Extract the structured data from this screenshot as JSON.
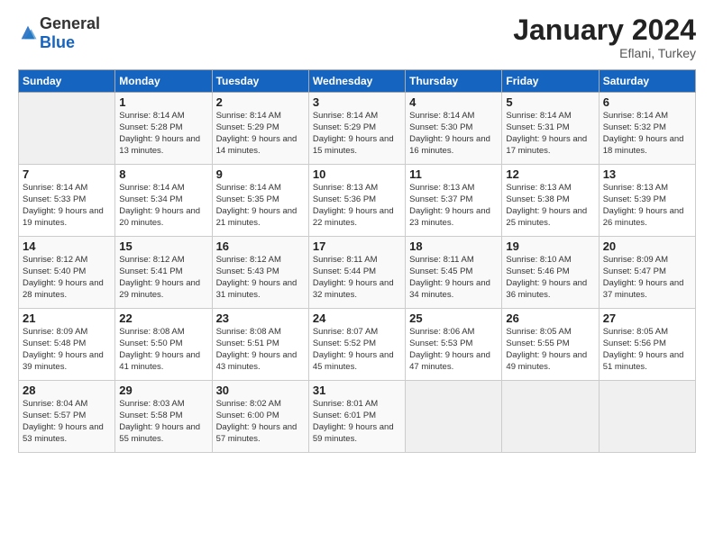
{
  "header": {
    "logo_general": "General",
    "logo_blue": "Blue",
    "month": "January 2024",
    "location": "Eflani, Turkey"
  },
  "days_of_week": [
    "Sunday",
    "Monday",
    "Tuesday",
    "Wednesday",
    "Thursday",
    "Friday",
    "Saturday"
  ],
  "weeks": [
    {
      "days": [
        {
          "num": "",
          "sunrise": "",
          "sunset": "",
          "daylight": ""
        },
        {
          "num": "1",
          "sunrise": "Sunrise: 8:14 AM",
          "sunset": "Sunset: 5:28 PM",
          "daylight": "Daylight: 9 hours and 13 minutes."
        },
        {
          "num": "2",
          "sunrise": "Sunrise: 8:14 AM",
          "sunset": "Sunset: 5:29 PM",
          "daylight": "Daylight: 9 hours and 14 minutes."
        },
        {
          "num": "3",
          "sunrise": "Sunrise: 8:14 AM",
          "sunset": "Sunset: 5:29 PM",
          "daylight": "Daylight: 9 hours and 15 minutes."
        },
        {
          "num": "4",
          "sunrise": "Sunrise: 8:14 AM",
          "sunset": "Sunset: 5:30 PM",
          "daylight": "Daylight: 9 hours and 16 minutes."
        },
        {
          "num": "5",
          "sunrise": "Sunrise: 8:14 AM",
          "sunset": "Sunset: 5:31 PM",
          "daylight": "Daylight: 9 hours and 17 minutes."
        },
        {
          "num": "6",
          "sunrise": "Sunrise: 8:14 AM",
          "sunset": "Sunset: 5:32 PM",
          "daylight": "Daylight: 9 hours and 18 minutes."
        }
      ]
    },
    {
      "days": [
        {
          "num": "7",
          "sunrise": "Sunrise: 8:14 AM",
          "sunset": "Sunset: 5:33 PM",
          "daylight": "Daylight: 9 hours and 19 minutes."
        },
        {
          "num": "8",
          "sunrise": "Sunrise: 8:14 AM",
          "sunset": "Sunset: 5:34 PM",
          "daylight": "Daylight: 9 hours and 20 minutes."
        },
        {
          "num": "9",
          "sunrise": "Sunrise: 8:14 AM",
          "sunset": "Sunset: 5:35 PM",
          "daylight": "Daylight: 9 hours and 21 minutes."
        },
        {
          "num": "10",
          "sunrise": "Sunrise: 8:13 AM",
          "sunset": "Sunset: 5:36 PM",
          "daylight": "Daylight: 9 hours and 22 minutes."
        },
        {
          "num": "11",
          "sunrise": "Sunrise: 8:13 AM",
          "sunset": "Sunset: 5:37 PM",
          "daylight": "Daylight: 9 hours and 23 minutes."
        },
        {
          "num": "12",
          "sunrise": "Sunrise: 8:13 AM",
          "sunset": "Sunset: 5:38 PM",
          "daylight": "Daylight: 9 hours and 25 minutes."
        },
        {
          "num": "13",
          "sunrise": "Sunrise: 8:13 AM",
          "sunset": "Sunset: 5:39 PM",
          "daylight": "Daylight: 9 hours and 26 minutes."
        }
      ]
    },
    {
      "days": [
        {
          "num": "14",
          "sunrise": "Sunrise: 8:12 AM",
          "sunset": "Sunset: 5:40 PM",
          "daylight": "Daylight: 9 hours and 28 minutes."
        },
        {
          "num": "15",
          "sunrise": "Sunrise: 8:12 AM",
          "sunset": "Sunset: 5:41 PM",
          "daylight": "Daylight: 9 hours and 29 minutes."
        },
        {
          "num": "16",
          "sunrise": "Sunrise: 8:12 AM",
          "sunset": "Sunset: 5:43 PM",
          "daylight": "Daylight: 9 hours and 31 minutes."
        },
        {
          "num": "17",
          "sunrise": "Sunrise: 8:11 AM",
          "sunset": "Sunset: 5:44 PM",
          "daylight": "Daylight: 9 hours and 32 minutes."
        },
        {
          "num": "18",
          "sunrise": "Sunrise: 8:11 AM",
          "sunset": "Sunset: 5:45 PM",
          "daylight": "Daylight: 9 hours and 34 minutes."
        },
        {
          "num": "19",
          "sunrise": "Sunrise: 8:10 AM",
          "sunset": "Sunset: 5:46 PM",
          "daylight": "Daylight: 9 hours and 36 minutes."
        },
        {
          "num": "20",
          "sunrise": "Sunrise: 8:09 AM",
          "sunset": "Sunset: 5:47 PM",
          "daylight": "Daylight: 9 hours and 37 minutes."
        }
      ]
    },
    {
      "days": [
        {
          "num": "21",
          "sunrise": "Sunrise: 8:09 AM",
          "sunset": "Sunset: 5:48 PM",
          "daylight": "Daylight: 9 hours and 39 minutes."
        },
        {
          "num": "22",
          "sunrise": "Sunrise: 8:08 AM",
          "sunset": "Sunset: 5:50 PM",
          "daylight": "Daylight: 9 hours and 41 minutes."
        },
        {
          "num": "23",
          "sunrise": "Sunrise: 8:08 AM",
          "sunset": "Sunset: 5:51 PM",
          "daylight": "Daylight: 9 hours and 43 minutes."
        },
        {
          "num": "24",
          "sunrise": "Sunrise: 8:07 AM",
          "sunset": "Sunset: 5:52 PM",
          "daylight": "Daylight: 9 hours and 45 minutes."
        },
        {
          "num": "25",
          "sunrise": "Sunrise: 8:06 AM",
          "sunset": "Sunset: 5:53 PM",
          "daylight": "Daylight: 9 hours and 47 minutes."
        },
        {
          "num": "26",
          "sunrise": "Sunrise: 8:05 AM",
          "sunset": "Sunset: 5:55 PM",
          "daylight": "Daylight: 9 hours and 49 minutes."
        },
        {
          "num": "27",
          "sunrise": "Sunrise: 8:05 AM",
          "sunset": "Sunset: 5:56 PM",
          "daylight": "Daylight: 9 hours and 51 minutes."
        }
      ]
    },
    {
      "days": [
        {
          "num": "28",
          "sunrise": "Sunrise: 8:04 AM",
          "sunset": "Sunset: 5:57 PM",
          "daylight": "Daylight: 9 hours and 53 minutes."
        },
        {
          "num": "29",
          "sunrise": "Sunrise: 8:03 AM",
          "sunset": "Sunset: 5:58 PM",
          "daylight": "Daylight: 9 hours and 55 minutes."
        },
        {
          "num": "30",
          "sunrise": "Sunrise: 8:02 AM",
          "sunset": "Sunset: 6:00 PM",
          "daylight": "Daylight: 9 hours and 57 minutes."
        },
        {
          "num": "31",
          "sunrise": "Sunrise: 8:01 AM",
          "sunset": "Sunset: 6:01 PM",
          "daylight": "Daylight: 9 hours and 59 minutes."
        },
        {
          "num": "",
          "sunrise": "",
          "sunset": "",
          "daylight": ""
        },
        {
          "num": "",
          "sunrise": "",
          "sunset": "",
          "daylight": ""
        },
        {
          "num": "",
          "sunrise": "",
          "sunset": "",
          "daylight": ""
        }
      ]
    }
  ]
}
